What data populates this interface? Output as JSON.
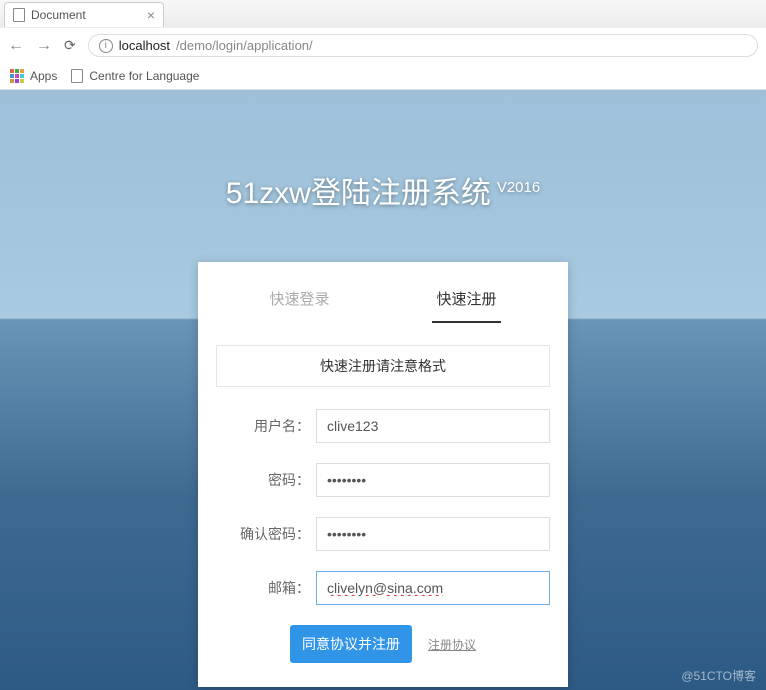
{
  "browser": {
    "tab_title": "Document",
    "url_host": "localhost",
    "url_path": "/demo/login/application/",
    "bookmarks": {
      "apps": "Apps",
      "item1": "Centre for Language"
    }
  },
  "page": {
    "title": "51zxw登陆注册系统",
    "version": "V2016"
  },
  "tabs": {
    "login": "快速登录",
    "register": "快速注册"
  },
  "form": {
    "notice": "快速注册请注意格式",
    "username_label": "用户名：",
    "username_value": "clive123",
    "password_label": "密码：",
    "password_value": "••••••••",
    "confirm_label": "确认密码：",
    "confirm_value": "••••••••",
    "email_label": "邮箱：",
    "email_value": "clivelyn@sina.com",
    "submit_label": "同意协议并注册",
    "agreement_link": "注册协议"
  },
  "watermark": "@51CTO博客"
}
